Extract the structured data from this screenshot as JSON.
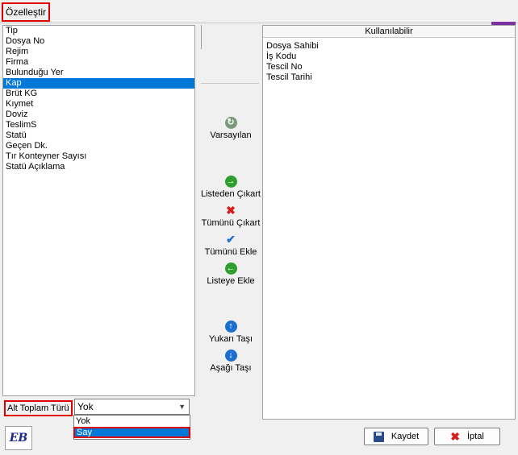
{
  "window": {
    "title": "Özelleştir",
    "help_icon": "?"
  },
  "left_list": {
    "items": [
      "Tip",
      "Dosya No",
      "Rejim",
      "Firma",
      "Bulunduğu Yer",
      "Kap",
      "Brüt KG",
      "Kıymet",
      "Doviz",
      "TeslimS",
      "Statü",
      "Geçen Dk.",
      "Tır Konteyner Sayısı",
      "Statü Açıklama"
    ],
    "selected_index": 5
  },
  "middle_buttons": {
    "defaults": "Varsayılan",
    "remove_from_list": "Listeden Çıkart",
    "remove_all": "Tümünü Çıkart",
    "add_all": "Tümünü Ekle",
    "add_to_list": "Listeye Ekle",
    "move_up": "Yukarı Taşı",
    "move_down": "Aşağı Taşı"
  },
  "right_panel": {
    "header": "Kullanılabilir",
    "items": [
      "Dosya Sahibi",
      "İş Kodu",
      "Tescil No",
      "Tescil Tarihi"
    ]
  },
  "subtotal": {
    "label": "Alt Toplam Türü",
    "value": "Yok",
    "options": [
      "Yok",
      "Say"
    ],
    "highlighted_option": "Say"
  },
  "footer": {
    "logo": "EB",
    "save": "Kaydet",
    "cancel": "İptal"
  },
  "colors": {
    "selection": "#0078d7",
    "highlight_box": "#e00000",
    "help_bg": "#7b2fa0"
  }
}
